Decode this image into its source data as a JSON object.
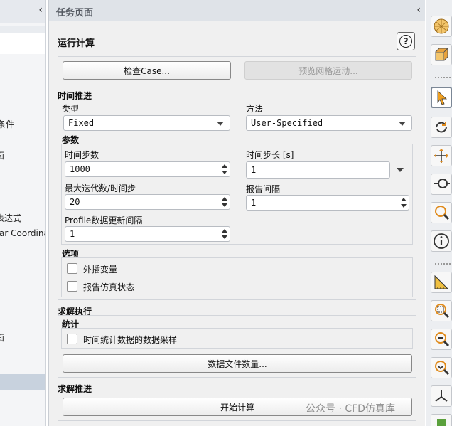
{
  "left_panel": {
    "items": [
      {
        "label": "条件"
      },
      {
        "label": "面"
      },
      {
        "label": "表达式"
      },
      {
        "label": "ar Coordina"
      },
      {
        "label": "面"
      }
    ]
  },
  "task_page": {
    "title": "任务页面",
    "run_section": {
      "title": "运行计算",
      "help_label": "?",
      "check_case_label": "检查Case...",
      "preview_mesh_label": "预览网格运动..."
    },
    "time_advance": {
      "title": "时间推进",
      "type_label": "类型",
      "type_value": "Fixed",
      "method_label": "方法",
      "method_value": "User-Specified"
    },
    "params": {
      "title": "参数",
      "time_steps_label": "时间步数",
      "time_steps_value": "1000",
      "time_step_size_label": "时间步长 [s]",
      "time_step_size_value": "1",
      "max_iter_label": "最大迭代数/时间步",
      "max_iter_value": "20",
      "report_interval_label": "报告间隔",
      "report_interval_value": "1",
      "profile_interval_label": "Profile数据更新间隔",
      "profile_interval_value": "1"
    },
    "options": {
      "title": "选项",
      "extrapolate_label": "外插变量",
      "report_sim_label": "报告仿真状态"
    },
    "solution_execution": {
      "title": "求解执行",
      "stats_title": "统计",
      "sampling_label": "时间统计数据的数据采样",
      "data_file_qty_label": "数据文件数量..."
    },
    "solution_advance": {
      "title": "求解推进",
      "start_calc_label": "开始计算"
    }
  },
  "toolbar": {
    "icons": [
      "sphere-mesh-icon",
      "cube-view-icon",
      "select-arrow-icon",
      "rotate-icon",
      "pan-icon",
      "zoom-probe-icon",
      "zoom-icon",
      "info-icon",
      "ruler-icon",
      "zoom-box-icon",
      "zoom-out-icon",
      "zoom-fit-icon",
      "axes-icon"
    ]
  },
  "watermark": "公众号 · CFD仿真库"
}
